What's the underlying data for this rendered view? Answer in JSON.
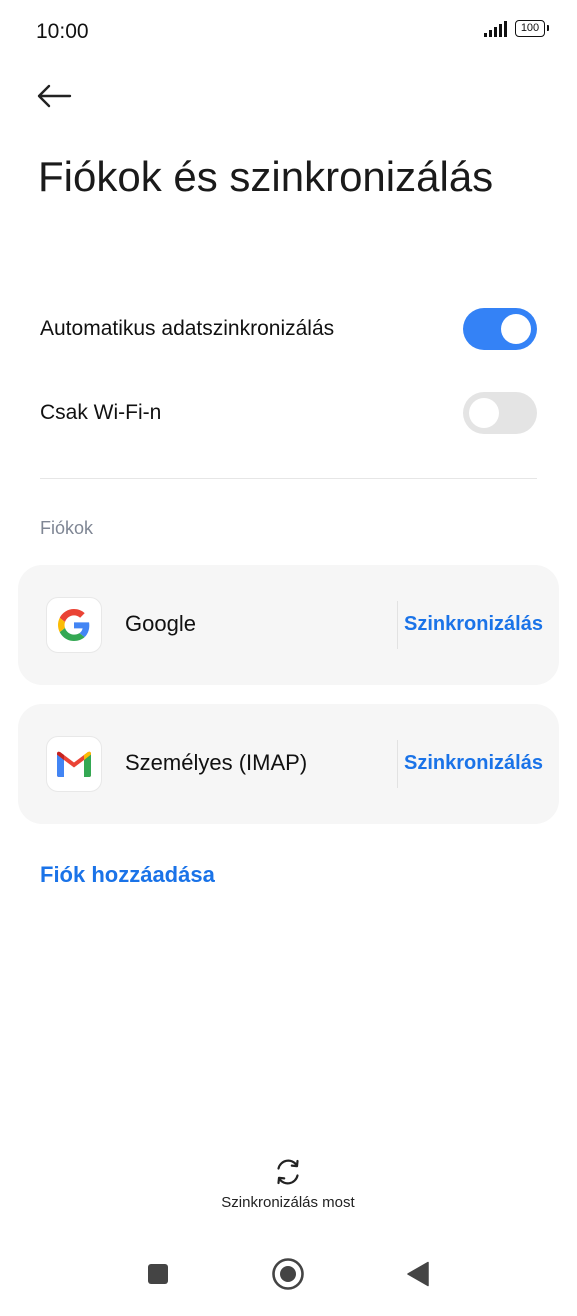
{
  "status_bar": {
    "time": "10:00",
    "battery": "100"
  },
  "header": {
    "title": "Fiókok és szinkronizálás"
  },
  "settings": {
    "auto_sync": {
      "label": "Automatikus adatszinkronizálás",
      "enabled": true
    },
    "wifi_only": {
      "label": "Csak Wi-Fi-n",
      "enabled": false
    }
  },
  "accounts": {
    "header": "Fiókok",
    "items": [
      {
        "name": "Google",
        "icon": "google-icon",
        "action": "Szinkronizálás"
      },
      {
        "name": "Személyes (IMAP)",
        "icon": "gmail-icon",
        "action": "Szinkronizálás"
      }
    ]
  },
  "add_account_label": "Fiók hozzáadása",
  "sync_now_label": "Szinkronizálás most",
  "colors": {
    "accent": "#1a73e8",
    "toggle_on": "#3482f6",
    "toggle_off": "#e4e4e4",
    "card_bg": "#f6f6f6"
  }
}
